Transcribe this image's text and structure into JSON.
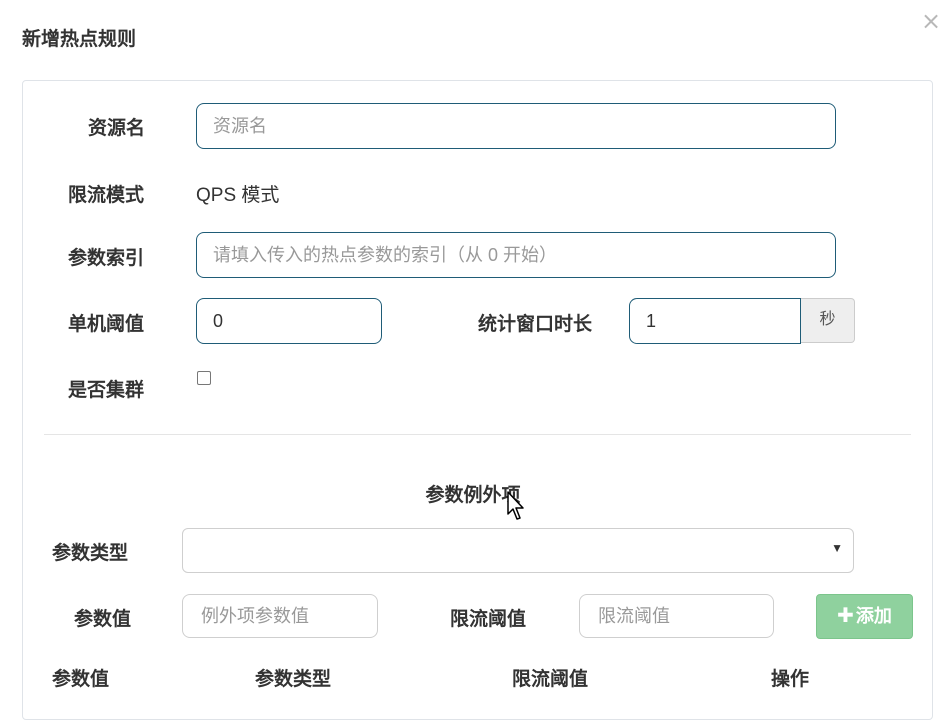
{
  "dialog": {
    "title": "新增热点规则",
    "close_glyph": "×"
  },
  "form": {
    "resource": {
      "label": "资源名",
      "placeholder": "资源名"
    },
    "mode": {
      "label": "限流模式",
      "value": "QPS 模式"
    },
    "param_index": {
      "label": "参数索引",
      "placeholder": "请填入传入的热点参数的索引（从 0 开始）"
    },
    "threshold": {
      "label": "单机阈值",
      "value": "0"
    },
    "window": {
      "label": "统计窗口时长",
      "value": "1",
      "unit": "秒"
    },
    "cluster": {
      "label": "是否集群",
      "checked": false
    }
  },
  "exceptions": {
    "title": "参数例外项",
    "param_type": {
      "label": "参数类型",
      "selected": ""
    },
    "param_value": {
      "label": "参数值",
      "placeholder": "例外项参数值"
    },
    "limit": {
      "label": "限流阈值",
      "placeholder": "限流阈值"
    },
    "add_button": {
      "icon": "plus-icon",
      "label": "添加"
    },
    "table_headers": [
      "参数值",
      "参数类型",
      "限流阈值",
      "操作"
    ]
  },
  "colors": {
    "input_border": "#1f5c77",
    "add_button": "#8fd19e"
  }
}
